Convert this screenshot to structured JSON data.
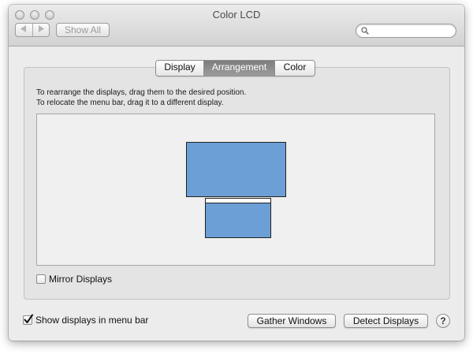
{
  "window": {
    "title": "Color LCD",
    "back_icon": "triangle-left",
    "forward_icon": "triangle-right",
    "show_all_label": "Show All",
    "search_value": "",
    "search_icon": "magnifier"
  },
  "tabs": [
    {
      "label": "Display",
      "active": false
    },
    {
      "label": "Arrangement",
      "active": true
    },
    {
      "label": "Color",
      "active": false
    }
  ],
  "arrangement": {
    "line1": "To rearrange the displays, drag them to the desired position.",
    "line2": "To relocate the menu bar, drag it to a different display.",
    "display_color": "#6b9fd6",
    "mirror_label": "Mirror Displays",
    "mirror_checked": false
  },
  "footer": {
    "show_in_menubar_label": "Show displays in menu bar",
    "show_in_menubar_checked": true,
    "gather_label": "Gather Windows",
    "detect_label": "Detect Displays",
    "help_label": "?"
  }
}
